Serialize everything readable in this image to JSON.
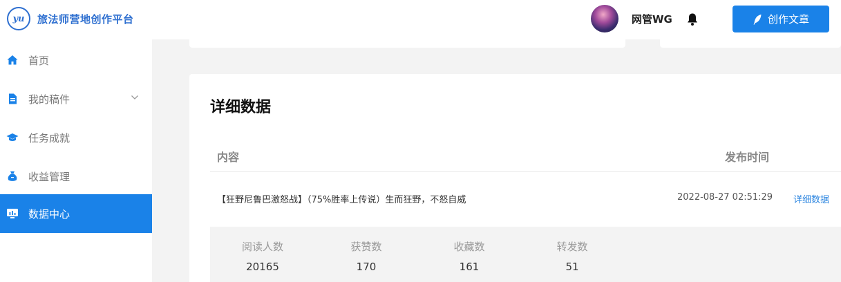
{
  "header": {
    "logo_mark": "yu",
    "app_title": "旅法师营地创作平台",
    "username": "网管WG",
    "create_button_label": "创作文章"
  },
  "sidebar": {
    "items": [
      {
        "label": "首页",
        "icon": "home-icon",
        "active": false
      },
      {
        "label": "我的稿件",
        "icon": "document-icon",
        "active": false,
        "has_submenu": true
      },
      {
        "label": "任务成就",
        "icon": "graduation-cap-icon",
        "active": false
      },
      {
        "label": "收益管理",
        "icon": "money-bag-icon",
        "active": false
      },
      {
        "label": "数据中心",
        "icon": "data-screen-icon",
        "active": true
      }
    ]
  },
  "main": {
    "title": "详细数据",
    "table": {
      "columns": [
        "内容",
        "发布时间"
      ],
      "rows": [
        {
          "content": "【狂野尼鲁巴激怒战】（75%胜率上传说）生而狂野，不怒自威",
          "publish_time": "2022-08-27 02:51:29",
          "action_label": "详细数据"
        }
      ]
    },
    "stats": [
      {
        "label": "阅读人数",
        "value": "20165"
      },
      {
        "label": "获赞数",
        "value": "170"
      },
      {
        "label": "收藏数",
        "value": "161"
      },
      {
        "label": "转发数",
        "value": "51"
      }
    ]
  },
  "colors": {
    "accent": "#1a82e8",
    "link": "#2d86e0",
    "logo": "#2e6fd0",
    "background": "#f3f3f3"
  }
}
